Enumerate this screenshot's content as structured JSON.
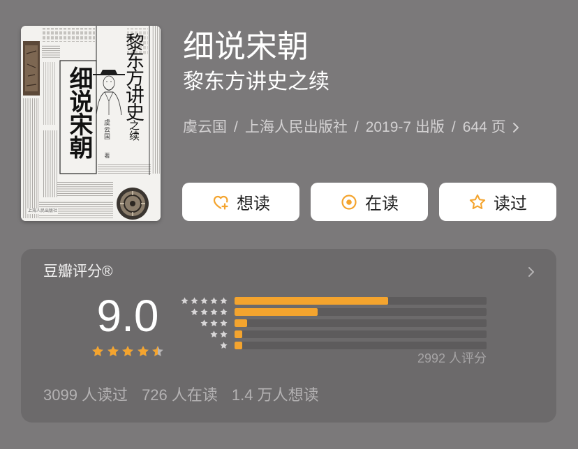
{
  "colors": {
    "page_bg": "#7b797a",
    "card_bg": "#6c6a6b",
    "accent": "#f4a42e",
    "star_empty": "#b8b6b7",
    "bar_track": "#5d5b5c",
    "mini_star": "#d8d6d7",
    "button_bg": "#ffffff",
    "button_text": "#1f1f1f",
    "title_text": "#ffffff",
    "meta_text": "#d3d1d2",
    "muted_text": "#b4b2b3",
    "count_text": "#a6a4a5"
  },
  "cover": {
    "title": "细说宋朝",
    "series_main": "黎东方讲史",
    "series_tail": "之续",
    "author": "虞云国",
    "author_suffix": "著",
    "publisher": "上海人民出版社"
  },
  "book": {
    "title": "细说宋朝",
    "subtitle": "黎东方讲史之续",
    "meta": {
      "author": "虞云国",
      "publisher": "上海人民出版社",
      "published": "2019-7 出版",
      "pages": "644 页",
      "separator": "/",
      "more_icon": "chevron-right-icon"
    }
  },
  "actions": [
    {
      "label": "想读",
      "icon": "heart-plus-icon"
    },
    {
      "label": "在读",
      "icon": "target-icon"
    },
    {
      "label": "读过",
      "icon": "star-outline-icon"
    }
  ],
  "rating": {
    "heading": "豆瓣评分®",
    "more_icon": "chevron-right-icon",
    "score": "9.0",
    "stars": 4.5,
    "distribution": [
      {
        "stars": 5,
        "fraction": 0.61
      },
      {
        "stars": 4,
        "fraction": 0.33
      },
      {
        "stars": 3,
        "fraction": 0.05
      },
      {
        "stars": 2,
        "fraction": 0.03
      },
      {
        "stars": 1,
        "fraction": 0.03
      }
    ],
    "count_label": "2992 人评分"
  },
  "stats": [
    "3099 人读过",
    "726 人在读",
    "1.4 万人想读"
  ]
}
